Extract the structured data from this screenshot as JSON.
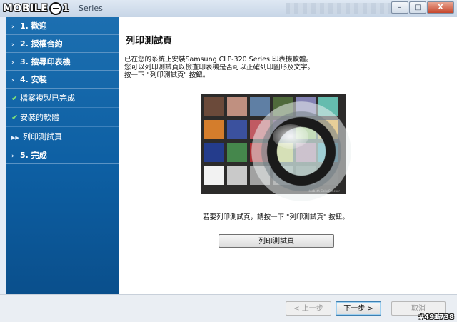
{
  "window": {
    "title": "Series",
    "logo": {
      "text_before": "MOBILE",
      "text_after": "1"
    },
    "watermark": "#491738",
    "caption_buttons": {
      "minimize": "–",
      "maximize": "□",
      "close": "X"
    }
  },
  "sidebar": {
    "items": [
      {
        "label": "1. 歡迎",
        "marker": "›",
        "level": "main"
      },
      {
        "label": "2. 授權合約",
        "marker": "›",
        "level": "main"
      },
      {
        "label": "3. 搜尋印表機",
        "marker": "›",
        "level": "main"
      },
      {
        "label": "4. 安裝",
        "marker": "›",
        "level": "main"
      },
      {
        "label": "檔案複製已完成",
        "marker": "✔",
        "level": "sub"
      },
      {
        "label": "安裝的軟體",
        "marker": "✔",
        "level": "sub"
      },
      {
        "label": "列印測試頁",
        "marker": "▶▶",
        "level": "sub",
        "current": true
      },
      {
        "label": "5. 完成",
        "marker": "›",
        "level": "main"
      }
    ]
  },
  "content": {
    "title": "列印測試頁",
    "lines": [
      "已在您的系統上安裝Samsung CLP-320 Series 印表機軟體。",
      "您可以列印測試頁以檢查印表機是否可以正確列印圖形及文字。",
      "按一下 \"列印測試頁\" 按鈕。"
    ],
    "image_caption": "Macbeth ColorChecker",
    "instruction": "若要列印測試頁，請按一下 \"列印測試頁\" 按鈕。",
    "print_button": "列印測試頁"
  },
  "footer": {
    "back": "< 上一步",
    "next": "下一步 >",
    "cancel": "取消"
  },
  "colors": {
    "sidebar_top": "#1c6fb0",
    "sidebar_bottom": "#0a4f8c",
    "checker": [
      "#6b4a3a",
      "#c09080",
      "#5f7fa4",
      "#4f6a3b",
      "#8382b3",
      "#65bcae",
      "#d47d2c",
      "#3b519e",
      "#c05a62",
      "#5a3a6d",
      "#a0bc3d",
      "#e0a52e",
      "#243c8c",
      "#45874c",
      "#ad2f33",
      "#e3c730",
      "#bc508a",
      "#0c84a7",
      "#f2f2f2",
      "#c9c9c9",
      "#a1a1a1",
      "#797979",
      "#555555",
      "#343434"
    ]
  }
}
